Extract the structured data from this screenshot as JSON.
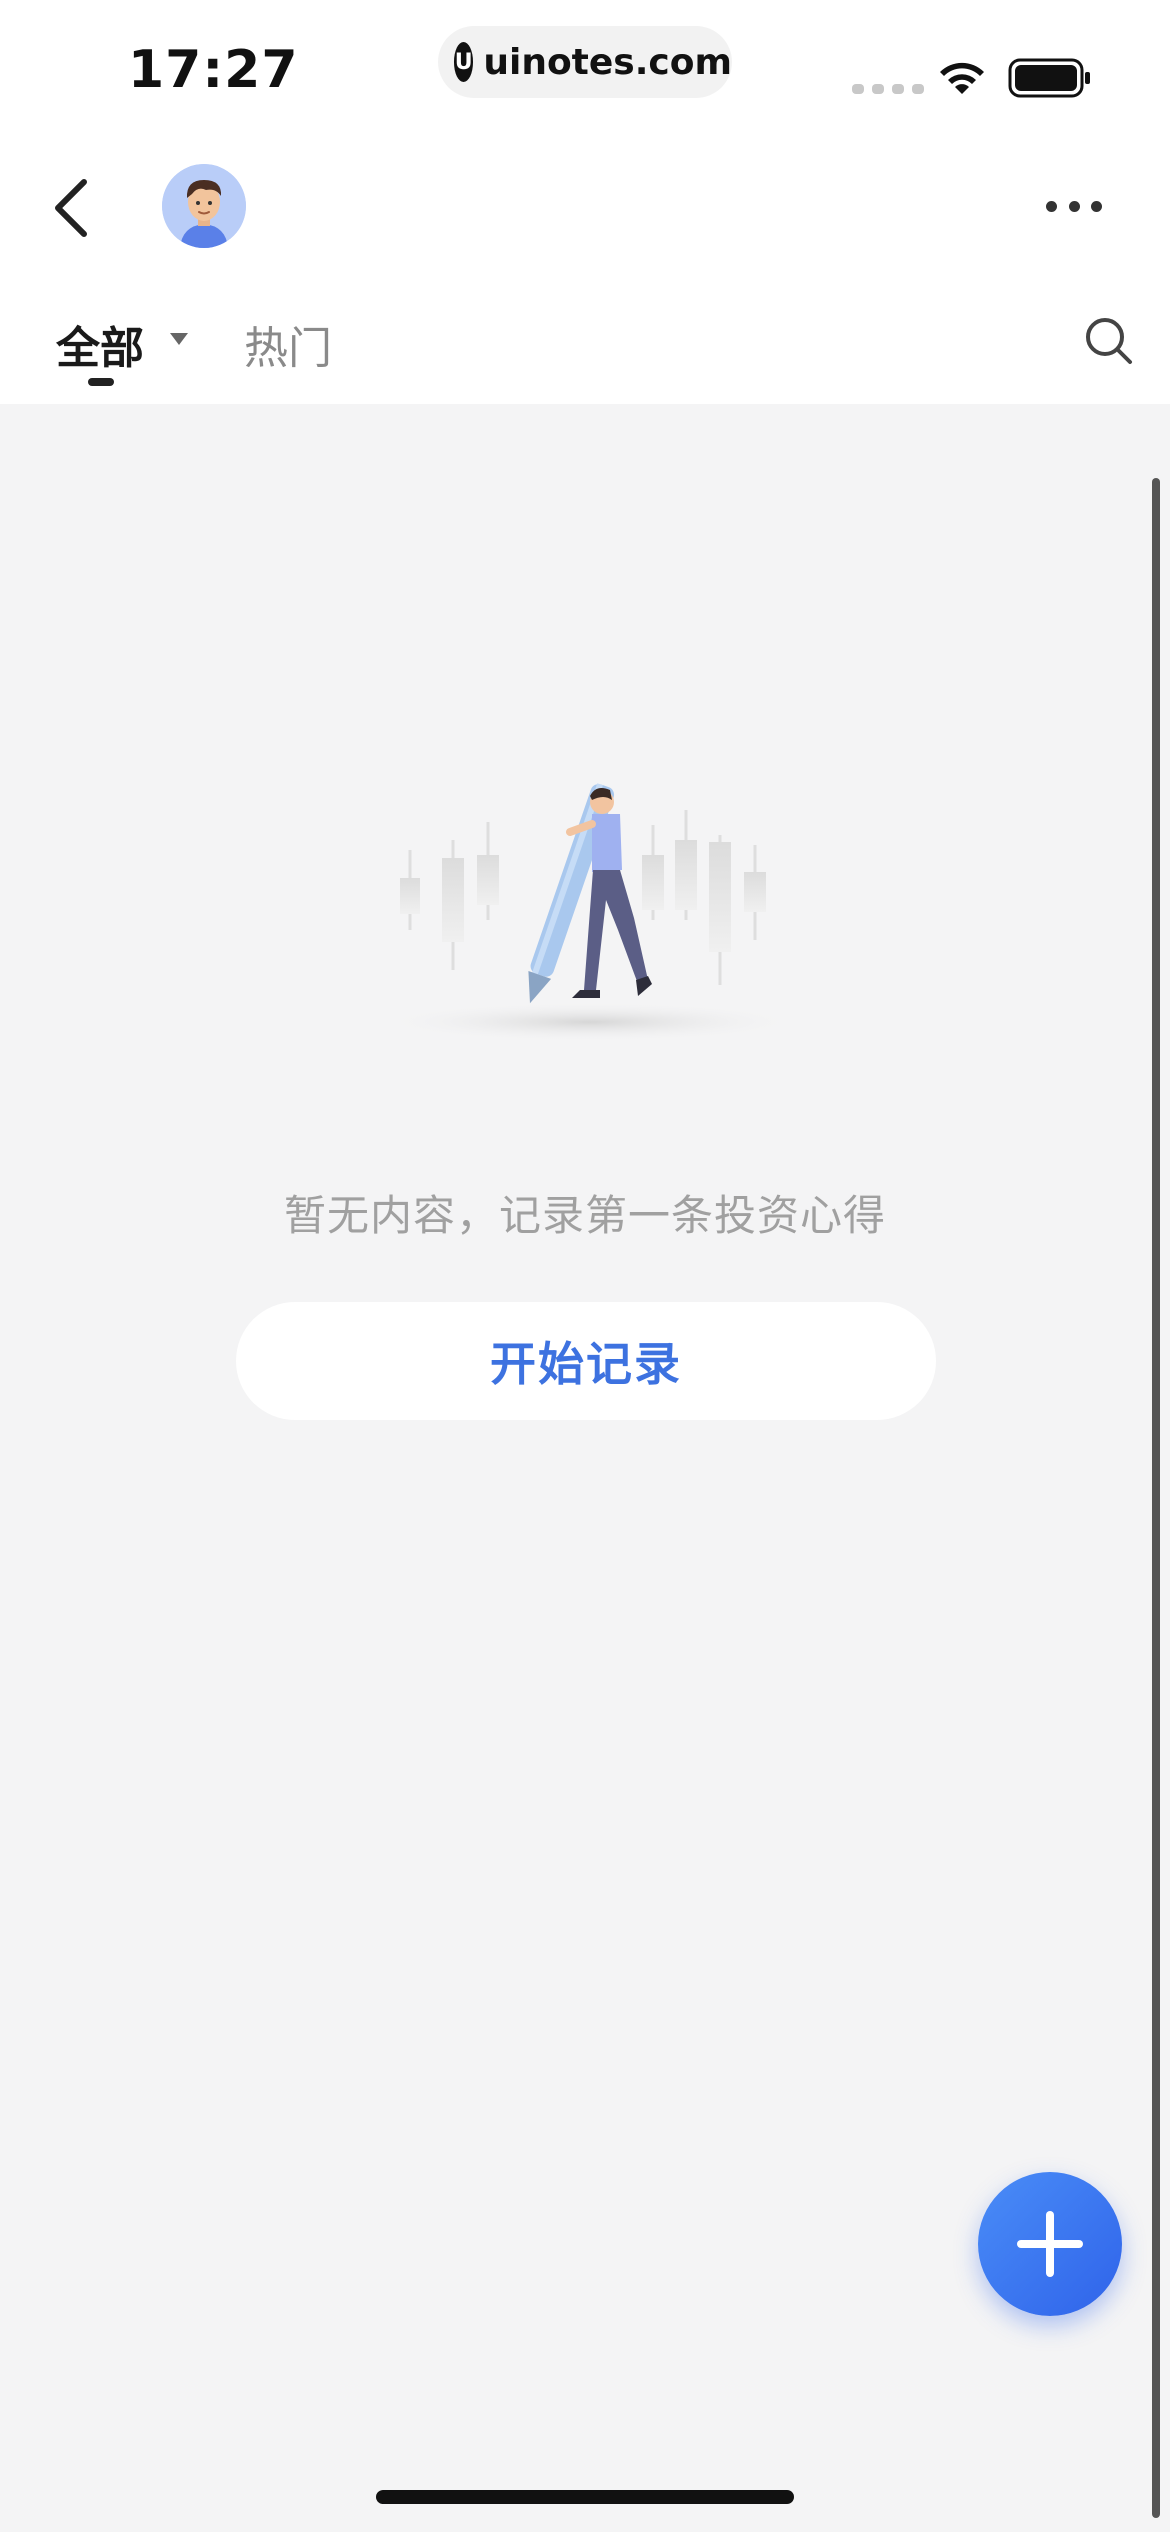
{
  "status_bar": {
    "time": "17:27",
    "url": "uinotes.com",
    "url_logo_letter": "U"
  },
  "nav": {
    "back_icon": "chevron-left-icon",
    "more_icon": "more-horizontal-icon"
  },
  "tabs": [
    {
      "label": "全部",
      "active": true,
      "has_dropdown": true
    },
    {
      "label": "热门",
      "active": false
    }
  ],
  "search_icon": "search-icon",
  "empty_state": {
    "message": "暂无内容，记录第一条投资心得",
    "button_label": "开始记录"
  },
  "fab_icon": "plus-icon",
  "colors": {
    "accent": "#3d72e0",
    "fab_start": "#4a8df7",
    "fab_end": "#2f63ea",
    "background": "#f4f4f5"
  }
}
